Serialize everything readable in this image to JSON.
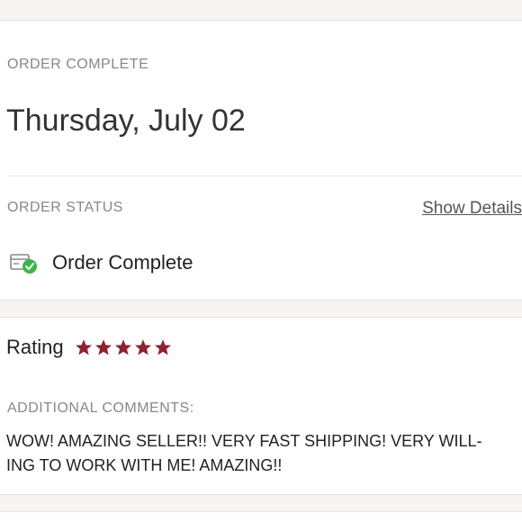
{
  "order": {
    "complete_label": "ORDER COMPLETE",
    "date": "Thursday, July 02",
    "status_label": "ORDER STATUS",
    "show_details": "Show Details",
    "status_text": "Order Complete",
    "status_icon": "package-check-icon"
  },
  "review": {
    "rating_label": "Rating",
    "rating_value": 5,
    "rating_max": 5,
    "star_color": "#8b2332",
    "comments_label": "ADDITIONAL COMMENTS:",
    "comment_line1": "WOW! AMAZING SELLER!! VERY FAST SHIPPING! VERY WILL-",
    "comment_line2": "ING TO WORK WITH ME! AMAZING!!"
  },
  "colors": {
    "success": "#3cb44b",
    "label_gray": "#8c8686"
  }
}
